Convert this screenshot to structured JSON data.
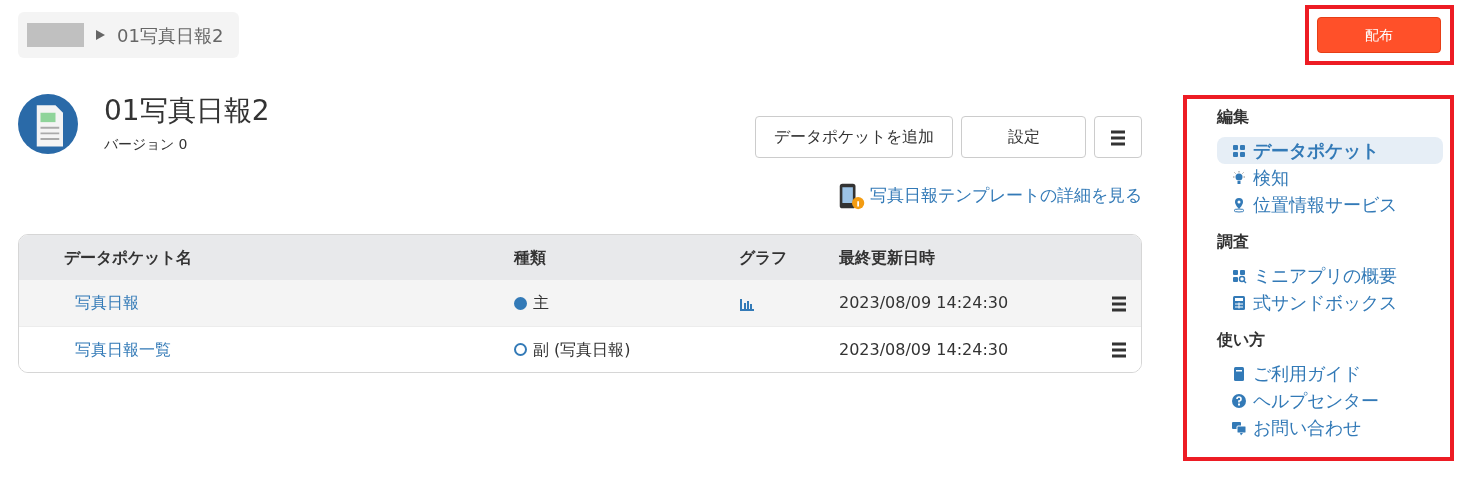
{
  "breadcrumb": {
    "redacted": true,
    "current": "01写真日報2"
  },
  "publish_button": {
    "label": "配布",
    "highlighted": true
  },
  "app": {
    "title": "01写真日報2",
    "version": "バージョン 0"
  },
  "toolbar": {
    "buttons": [
      "データポケットを追加",
      "設定"
    ]
  },
  "template_link": "写真日報テンプレートの詳細を見る",
  "table": {
    "columns": [
      "データポケット名",
      "種類",
      "グラフ",
      "最終更新日時"
    ],
    "rows": [
      {
        "name": "写真日報",
        "type": "主",
        "primary": true,
        "graph": true,
        "updated": "2023/08/09 14:24:30"
      },
      {
        "name": "写真日報一覧",
        "type": "副 (写真日報)",
        "primary": false,
        "graph": false,
        "updated": "2023/08/09 14:24:30"
      }
    ]
  },
  "sidebar": {
    "highlighted": true,
    "sections": [
      {
        "title": "編集",
        "items": [
          {
            "label": "データポケット",
            "kind": "grid",
            "selected": true
          },
          {
            "label": "検知",
            "kind": "bulb",
            "selected": false
          },
          {
            "label": "位置情報サービス",
            "kind": "pin",
            "selected": false
          }
        ]
      },
      {
        "title": "調査",
        "items": [
          {
            "label": "ミニアプリの概要",
            "kind": "gridsearch",
            "selected": false
          },
          {
            "label": "式サンドボックス",
            "kind": "calc",
            "selected": false
          }
        ]
      },
      {
        "title": "使い方",
        "items": [
          {
            "label": "ご利用ガイド",
            "kind": "book",
            "selected": false
          },
          {
            "label": "ヘルプセンター",
            "kind": "help",
            "selected": false
          },
          {
            "label": "お問い合わせ",
            "kind": "chat",
            "selected": false
          }
        ]
      }
    ]
  }
}
